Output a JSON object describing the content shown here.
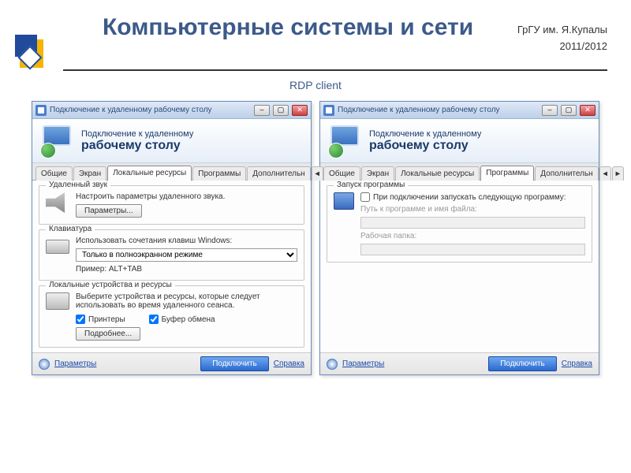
{
  "slide": {
    "title": "Компьютерные системы и сети",
    "org": "ГрГУ им. Я.Купалы",
    "year": "2011/2012",
    "subtitle": "RDP client"
  },
  "common": {
    "window_title": "Подключение к удаленному рабочему столу",
    "banner_line1": "Подключение к удаленному",
    "banner_line2": "рабочему столу",
    "tabs": {
      "general": "Общие",
      "display": "Экран",
      "local": "Локальные ресурсы",
      "programs": "Программы",
      "advanced": "Дополнительн",
      "scroll_left": "◂",
      "scroll_right": "▸"
    },
    "bottom": {
      "options": "Параметры",
      "connect": "Подключить",
      "help": "Справка"
    }
  },
  "left": {
    "audio": {
      "title": "Удаленный звук",
      "desc": "Настроить параметры удаленного звука.",
      "btn": "Параметры..."
    },
    "keyboard": {
      "title": "Клавиатура",
      "desc": "Использовать сочетания клавиш Windows:",
      "select": "Только в полноэкранном режиме",
      "example": "Пример: ALT+TAB"
    },
    "devices": {
      "title": "Локальные устройства и ресурсы",
      "desc": "Выберите устройства и ресурсы, которые следует использовать во время удаленного сеанса.",
      "printers": "Принтеры",
      "clipboard": "Буфер обмена",
      "more": "Подробнее..."
    }
  },
  "right": {
    "programs": {
      "title": "Запуск программы",
      "checkbox": "При подключении запускать следующую программу:",
      "path_label": "Путь к программе и имя файла:",
      "folder_label": "Рабочая папка:"
    }
  }
}
